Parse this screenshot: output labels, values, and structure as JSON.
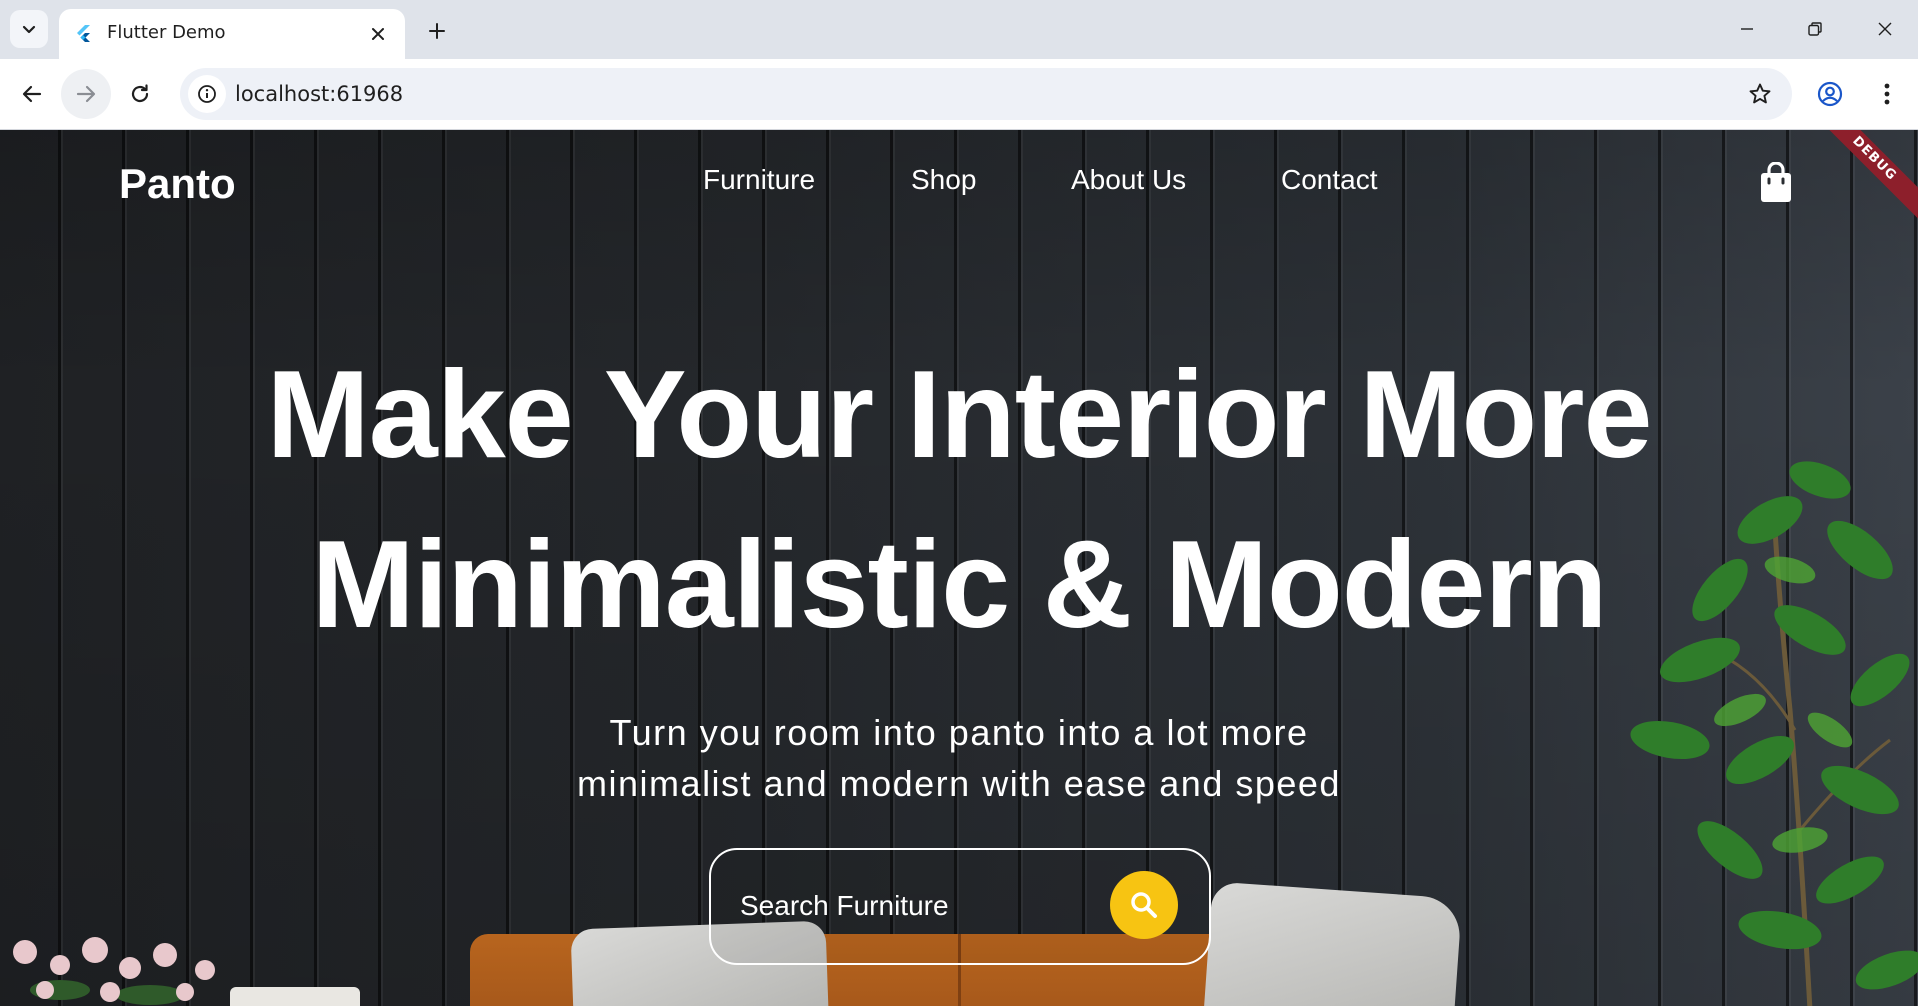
{
  "browser": {
    "tab_title": "Flutter Demo",
    "url": "localhost:61968"
  },
  "app": {
    "brand": "Panto",
    "nav": [
      {
        "label": "Furniture"
      },
      {
        "label": "Shop"
      },
      {
        "label": "About Us"
      },
      {
        "label": "Contact"
      }
    ],
    "debug_banner": "DEBUG",
    "hero": {
      "title_line1": "Make Your Interior More",
      "title_line2": "Minimalistic & Modern",
      "subtitle_line1": "Turn you room into panto into a lot more",
      "subtitle_line2": "minimalist and modern with ease and speed"
    },
    "search": {
      "placeholder": "Search Furniture"
    }
  },
  "icons": {
    "cart": "shopping-bag-icon",
    "search": "search-icon"
  },
  "colors": {
    "accent": "#f7c412",
    "text": "#ffffff",
    "debug_ribbon": "#8d1f2b"
  }
}
